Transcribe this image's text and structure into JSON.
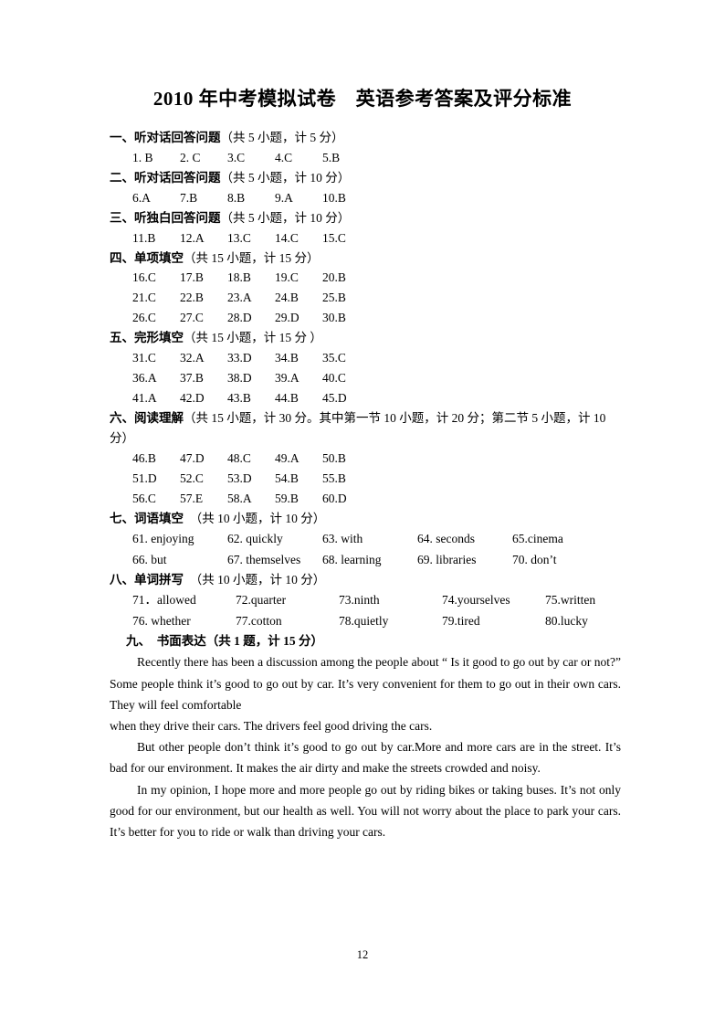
{
  "document": {
    "title": "2010 年中考模拟试卷　英语参考答案及评分标准",
    "page_number": "12"
  },
  "sections": [
    {
      "label": "一、听对话回答问题",
      "note": "（共 5 小题，计 5 分）",
      "rows": [
        [
          "1. B",
          "2. C",
          "3.C",
          "4.C",
          "5.B"
        ]
      ]
    },
    {
      "label": "二、听对话回答问题",
      "note": "（共 5 小题，计 10 分）",
      "rows": [
        [
          "6.A",
          "7.B",
          "8.B",
          "9.A",
          "10.B"
        ]
      ]
    },
    {
      "label": "三、听独白回答问题",
      "note": "（共 5 小题，计 10 分）",
      "rows": [
        [
          "11.B",
          "12.A",
          "13.C",
          "14.C",
          "15.C"
        ]
      ]
    },
    {
      "label": "四、单项填空",
      "note": "（共 15 小题，计 15 分）",
      "rows": [
        [
          "16.C",
          "17.B",
          "18.B",
          "19.C",
          "20.B"
        ],
        [
          "21.C",
          "22.B",
          "23.A",
          "24.B",
          "25.B"
        ],
        [
          "26.C",
          "27.C",
          "28.D",
          "29.D",
          "30.B"
        ]
      ]
    },
    {
      "label": "五、完形填空",
      "note": "（共 15 小题，计 15 分 ）",
      "rows": [
        [
          "31.C",
          "32.A",
          "33.D",
          "34.B",
          "35.C"
        ],
        [
          "36.A",
          "37.B",
          "38.D",
          "39.A",
          "40.C"
        ],
        [
          "41.A",
          "42.D",
          "43.B",
          "44.B",
          "45.D"
        ]
      ]
    },
    {
      "label": "六、阅读理解",
      "note": "（共 15 小题，计 30 分。其中第一节 10 小题，计 20 分；第二节 5 小题，计 10 分）",
      "rows": [
        [
          "46.B",
          "47.D",
          "48.C",
          "49.A",
          "50.B"
        ],
        [
          "51.D",
          "52.C",
          "53.D",
          "54.B",
          "55.B"
        ],
        [
          "56.C",
          "57.E",
          "58.A",
          "59.B",
          "60.D"
        ]
      ]
    },
    {
      "label": "七、词语填空",
      "note": "　（共 10 小题，计 10 分）",
      "word_rows": [
        [
          "61. enjoying",
          "62. quickly",
          "63. with",
          "64. seconds",
          "65.cinema"
        ],
        [
          "66. but",
          "67. themselves",
          "68. learning",
          "69. libraries",
          "70. don’t"
        ]
      ]
    },
    {
      "label": "八、单词拼写",
      "note": "　（共 10 小题，计 10 分）",
      "word_rows": [
        [
          "71．allowed",
          "72.quarter",
          "73.ninth",
          "74.yourselves",
          "75.written"
        ],
        [
          "76. whether",
          "77.cotton",
          "78.quietly",
          "79.tired",
          "80.lucky"
        ]
      ]
    },
    {
      "label": "九、　书面表达",
      "note": "（共 1 题，计 15 分）"
    }
  ],
  "essay": {
    "paragraphs": [
      {
        "indent": true,
        "text": "Recently there has been a discussion among the people about “ Is it good to go out by car or not?”Some people think it’s good to go out by car. It’s very convenient for them to go out in their own cars. They will feel comfortable"
      },
      {
        "indent": false,
        "text": "when they drive their cars. The drivers feel good driving the cars."
      },
      {
        "indent": true,
        "text": "But other people don’t think it’s good to go out by car.More and more cars are in the street. It’s bad for our environment. It makes the air dirty and make the streets crowded and noisy."
      },
      {
        "indent": true,
        "text": "In my opinion, I hope more and more people go out by riding bikes or taking buses. It’s not only good for our environment, but our health as well. You will not worry about the place to park your cars. It’s better for you to ride or walk than driving your cars."
      }
    ]
  }
}
